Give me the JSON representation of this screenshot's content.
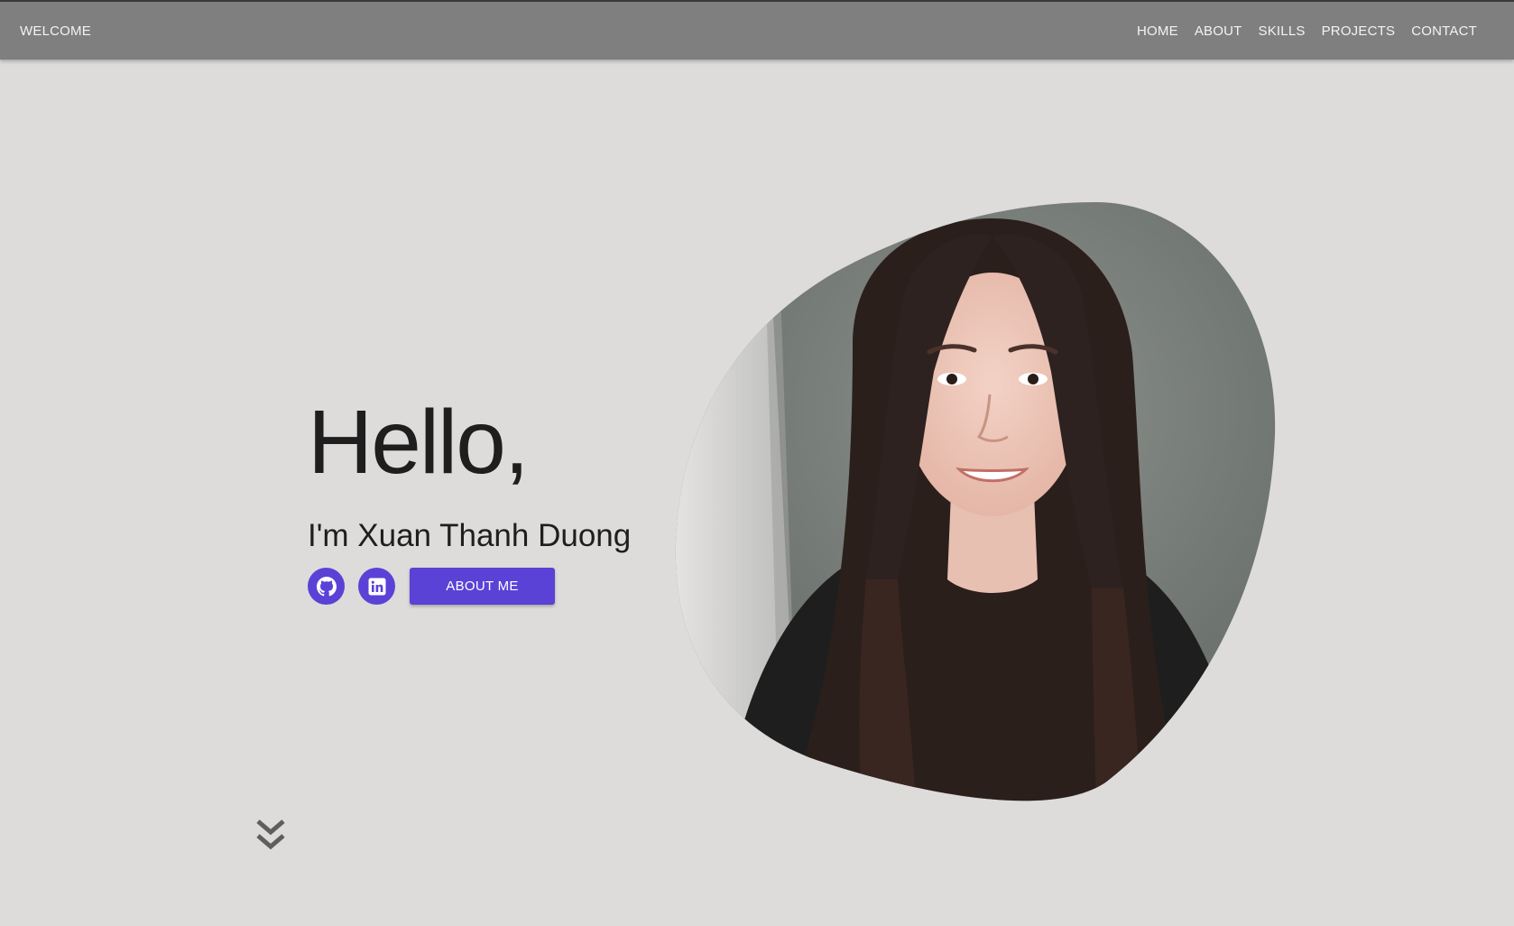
{
  "navbar": {
    "brand": "WELCOME",
    "links": [
      {
        "label": "HOME"
      },
      {
        "label": "ABOUT"
      },
      {
        "label": "SKILLS"
      },
      {
        "label": "PROJECTS"
      },
      {
        "label": "CONTACT"
      }
    ]
  },
  "hero": {
    "greeting": "Hello,",
    "intro": "I'm Xuan Thanh Duong",
    "about_button": "ABOUT ME",
    "social": [
      {
        "icon": "github-icon"
      },
      {
        "icon": "linkedin-icon"
      }
    ],
    "scroll_icon": "double-chevron-down-icon"
  },
  "colors": {
    "accent": "#5b42d6",
    "navbar_bg": "#7f7f80",
    "page_bg": "#dddcdb",
    "text": "#1e1e1e"
  }
}
